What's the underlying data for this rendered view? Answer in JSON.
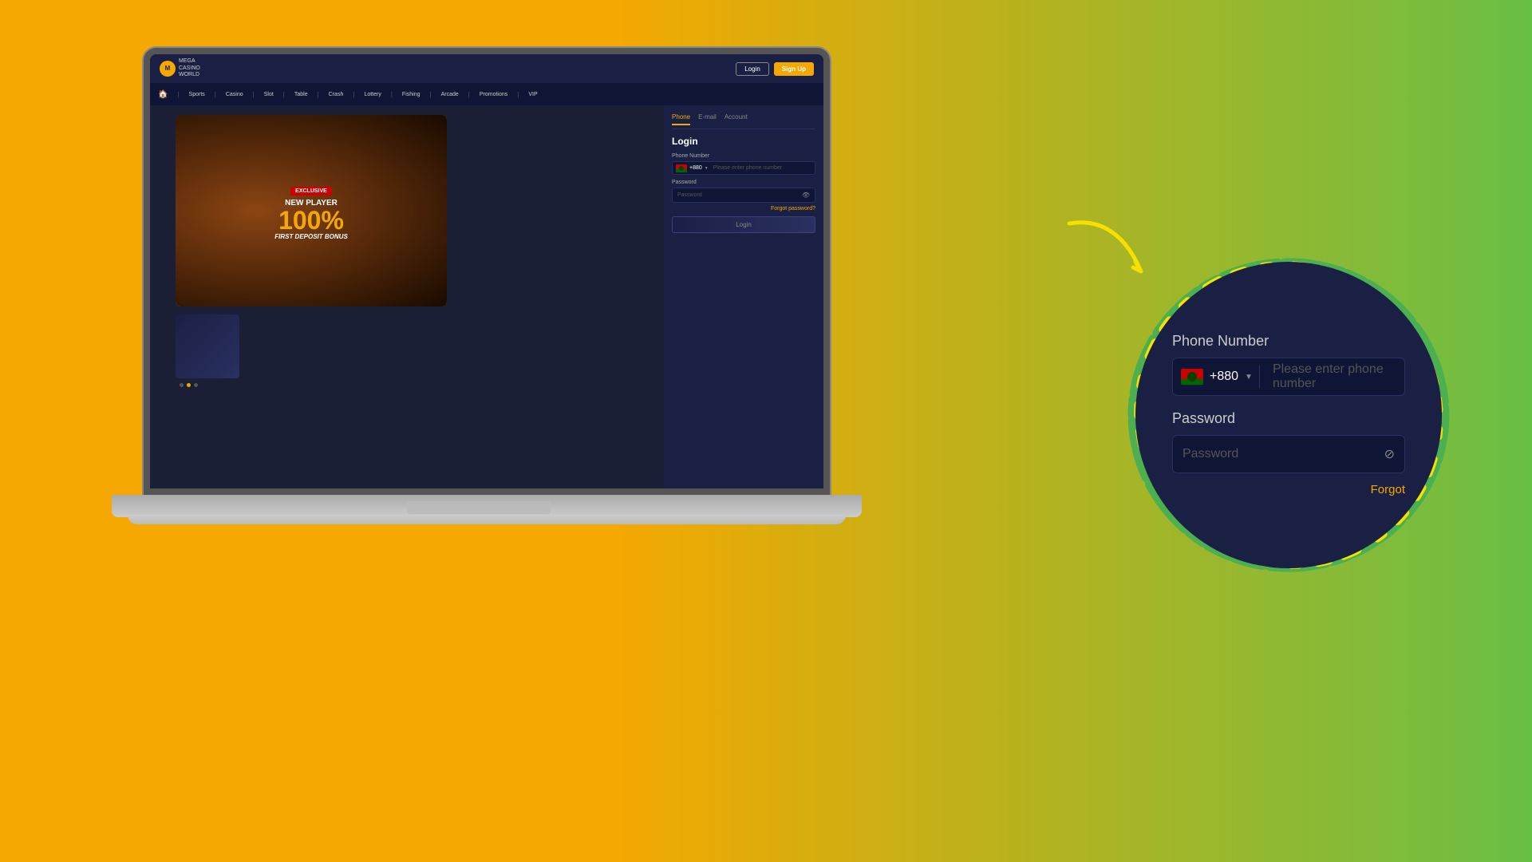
{
  "background": {
    "color_left": "#f5a800",
    "color_right": "#6abf45"
  },
  "laptop": {
    "screen_bg": "#1a1f35"
  },
  "casino_site": {
    "logo": {
      "line1": "MEGA",
      "line2": "CASINO",
      "line3": "WORLD"
    },
    "top_buttons": {
      "login": "Login",
      "signup": "Sign Up"
    },
    "nav_items": [
      "Sports",
      "Casino",
      "Slot",
      "Table",
      "Crash",
      "Lottery",
      "Fishing",
      "Arcade",
      "Promotions",
      "VIP"
    ],
    "banner": {
      "exclusive": "EXCLUSIVE",
      "line1": "NEW PLAYER",
      "line2": "100%",
      "line3": "FIRST DEPOSIT BONUS"
    },
    "login_panel": {
      "tabs": [
        "Phone",
        "E-mail",
        "Account"
      ],
      "active_tab": "Phone",
      "title": "Login",
      "phone_label": "Phone Number",
      "country_code": "+880",
      "phone_placeholder": "Please enter phone number",
      "password_label": "Password",
      "password_placeholder": "Password",
      "forgot_link": "Forgot password?",
      "login_button": "Login"
    }
  },
  "zoomed": {
    "phone_label": "Phone Number",
    "country_code": "+880",
    "phone_placeholder": "Please enter phone number",
    "password_label": "Password",
    "password_placeholder": "Password",
    "forgot_link": "Forgot"
  }
}
